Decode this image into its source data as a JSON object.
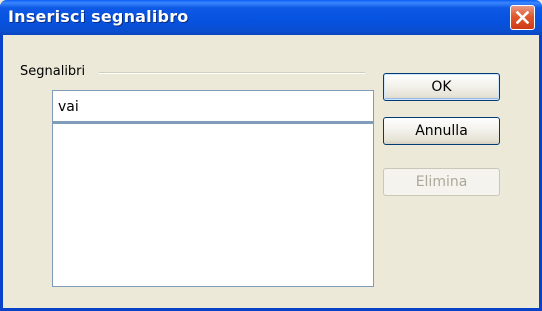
{
  "window": {
    "title": "Inserisci segnalibro"
  },
  "group": {
    "label": "Segnalibri"
  },
  "bookmark_input": {
    "value": "vai"
  },
  "bookmark_list": {
    "items": []
  },
  "buttons": {
    "ok": "OK",
    "cancel": "Annulla",
    "delete": "Elimina"
  },
  "icons": {
    "close": "close-icon"
  },
  "colors": {
    "titlebar": "#0a55e0",
    "close_button": "#d9461f",
    "dialog_bg": "#ece9d8"
  }
}
